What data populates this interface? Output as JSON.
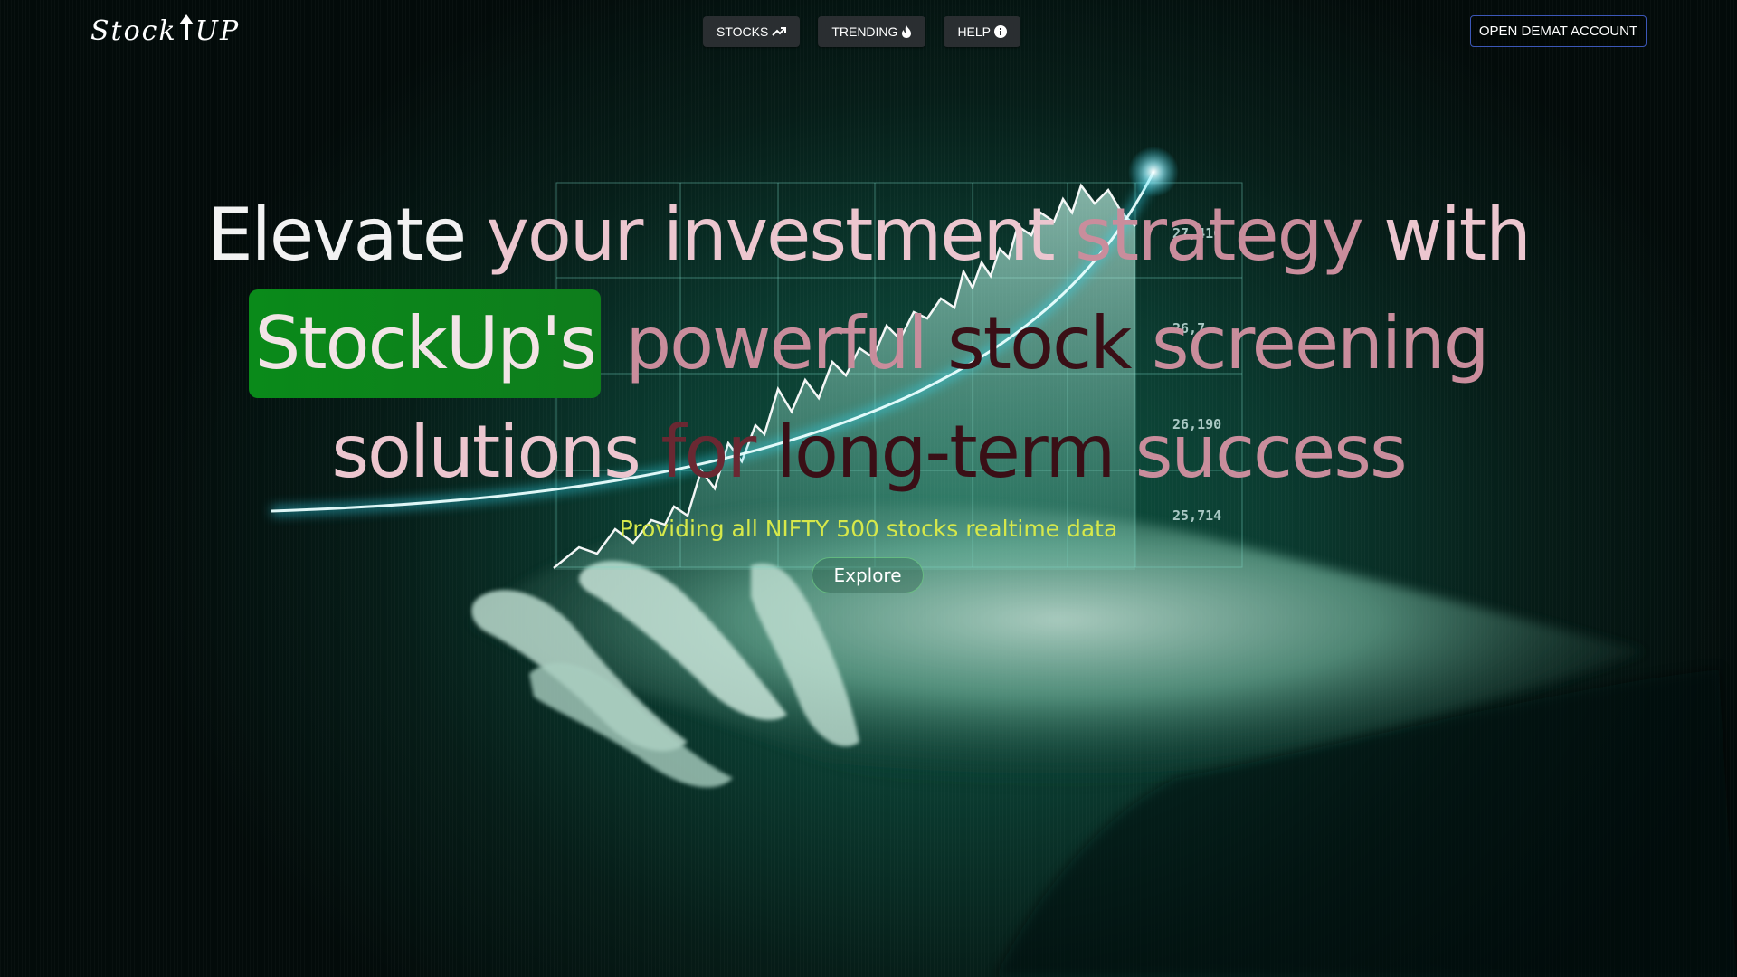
{
  "nav": {
    "logo_left": "Stock",
    "logo_right": "UP",
    "menu": [
      {
        "label": "STOCKS",
        "icon": "trending-up-icon"
      },
      {
        "label": "TRENDING",
        "icon": "fire-icon"
      },
      {
        "label": "HELP",
        "icon": "info-icon"
      }
    ],
    "cta_label": "OPEN DEMAT ACCOUNT"
  },
  "hero": {
    "line1": [
      "Elevate",
      "your",
      "investment",
      "strategy",
      "with"
    ],
    "line2": [
      "StockUp's",
      "powerful",
      "stock",
      "screening"
    ],
    "line3": [
      "solutions",
      "for",
      "long-term",
      "success"
    ],
    "tagline": "Providing all NIFTY 500 stocks realtime data",
    "explore_label": "Explore"
  },
  "background_chart": {
    "labels": [
      "27,410",
      "26,7..",
      "26,190",
      "25,714"
    ]
  },
  "colors": {
    "brand_highlight": "#0a8a1a",
    "tagline": "#d6e84a",
    "cta_border": "#3c57b8",
    "nav_button_bg": "#2a2e31"
  }
}
